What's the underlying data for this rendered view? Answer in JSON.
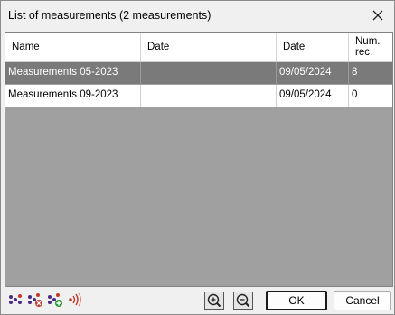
{
  "window": {
    "title": "List of measurements (2 measurements)"
  },
  "grid": {
    "columns": [
      "Name",
      "Date",
      "Date",
      "Num.\nrec."
    ],
    "rows": [
      {
        "name": "Measurements 05-2023",
        "date1": "",
        "date2": "09/05/2024",
        "num": "8",
        "selected": true
      },
      {
        "name": "Measurements 09-2023",
        "date1": "",
        "date2": "09/05/2024",
        "num": "0",
        "selected": false
      }
    ]
  },
  "toolbar": {
    "icons": [
      "points-icon",
      "delete-points-icon",
      "add-points-icon",
      "signal-icon"
    ],
    "zoom_in": "zoom-in-icon",
    "zoom_out": "zoom-out-icon"
  },
  "buttons": {
    "ok_label": "OK",
    "cancel_label": "Cancel"
  },
  "colors": {
    "selected_row": "#7a7a7a",
    "grid_background": "#a0a0a0",
    "icon_purple": "#4b2a83",
    "icon_red": "#c0392b",
    "icon_green": "#2e9c3a"
  }
}
